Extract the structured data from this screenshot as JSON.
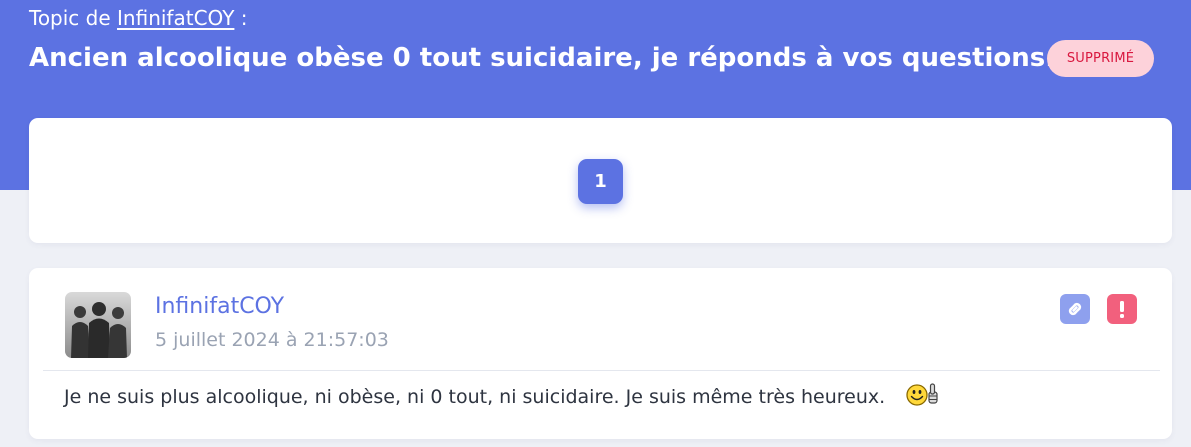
{
  "header": {
    "topic_prefix": "Topic de",
    "topic_author": "InfinifatCOY",
    "topic_suffix": ":",
    "title": "Ancien alcoolique obèse 0 tout suicidaire, je réponds à vos questions.",
    "status_badge": "SUPPRIMÉ"
  },
  "pagination": {
    "current_page": "1"
  },
  "post": {
    "author": "InfinifatCOY",
    "date": "5 juillet 2024 à 21:57:03",
    "body": "Je ne suis plus alcoolique, ni obèse, ni 0 tout, ni suicidaire. Je suis même très heureux.",
    "link_icon": "link-icon",
    "report_icon": "exclamation-icon",
    "smiley_icon": "thumbs-up-smiley-icon"
  },
  "colors": {
    "accent": "#5c72e2",
    "badge_bg": "#fdd2da",
    "badge_text": "#d9183f",
    "report": "#f2607d",
    "link": "#8ea0ee"
  }
}
